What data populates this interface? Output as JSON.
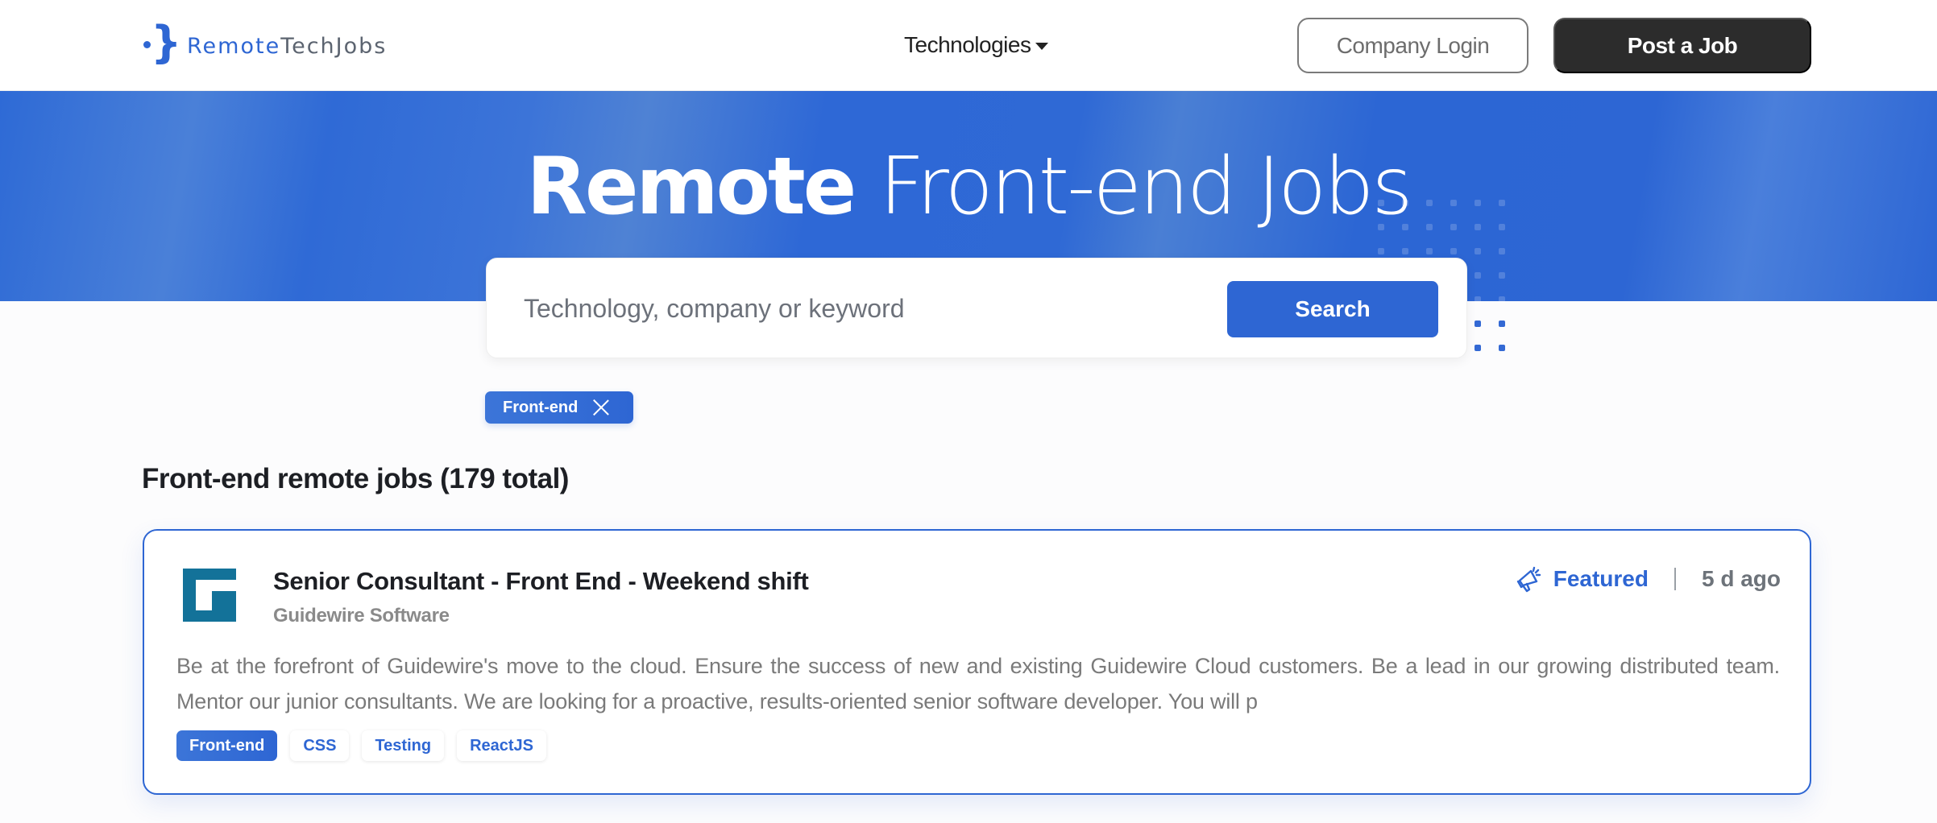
{
  "header": {
    "logo": {
      "part1": "Remote",
      "part2": "TechJobs",
      "mark_icon": "curly-brace-logo-icon"
    },
    "nav": {
      "technologies_label": "Technologies"
    },
    "company_login_label": "Company Login",
    "post_job_label": "Post a Job"
  },
  "hero": {
    "title_bold": "Remote",
    "title_light": "Front-end Jobs"
  },
  "search": {
    "placeholder": "Technology, company or keyword",
    "value": "",
    "button_label": "Search"
  },
  "active_filters": [
    {
      "label": "Front-end",
      "remove_icon": "close-icon"
    }
  ],
  "results": {
    "heading_bold": "Front-end remote jobs",
    "heading_count": "(179 total)"
  },
  "jobs": [
    {
      "title": "Senior Consultant - Front End - Weekend shift",
      "company": "Guidewire Software",
      "company_logo_icon": "guidewire-logo-icon",
      "featured_label": "Featured",
      "featured_icon": "megaphone-icon",
      "posted": "5 d ago",
      "description": "Be at the forefront of Guidewire's move to the cloud. Ensure the success of new and existing Guidewire Cloud customers. Be a lead in our growing distributed team. Mentor our junior consultants. We are looking for a proactive, results-oriented senior software developer. You will p",
      "tags": [
        {
          "label": "Front-end",
          "active": true
        },
        {
          "label": "CSS",
          "active": false
        },
        {
          "label": "Testing",
          "active": false
        },
        {
          "label": "ReactJS",
          "active": false
        }
      ]
    }
  ],
  "colors": {
    "brand": "#2e66d3",
    "dark_button": "#2c2c2c",
    "company_logo": "#137299"
  }
}
